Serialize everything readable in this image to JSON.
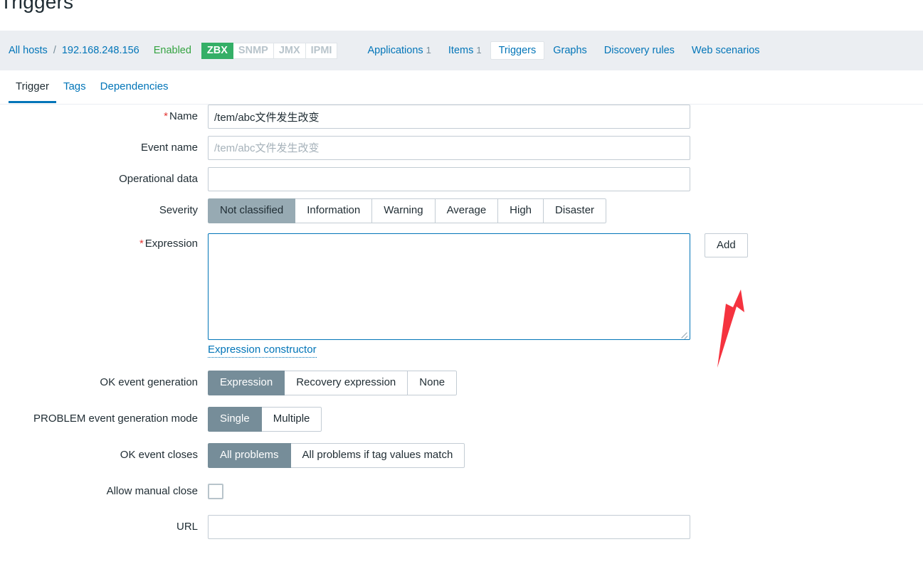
{
  "page": {
    "title": "Triggers"
  },
  "host_nav": {
    "all_hosts_label": "All hosts",
    "separator": "/",
    "host_name": "192.168.248.156",
    "status": "Enabled",
    "interfaces": [
      {
        "label": "ZBX",
        "active": true
      },
      {
        "label": "SNMP",
        "active": false
      },
      {
        "label": "JMX",
        "active": false
      },
      {
        "label": "IPMI",
        "active": false
      }
    ],
    "links": [
      {
        "label": "Applications",
        "count": "1",
        "selected": false
      },
      {
        "label": "Items",
        "count": "1",
        "selected": false
      },
      {
        "label": "Triggers",
        "count": "",
        "selected": true
      },
      {
        "label": "Graphs",
        "count": "",
        "selected": false
      },
      {
        "label": "Discovery rules",
        "count": "",
        "selected": false
      },
      {
        "label": "Web scenarios",
        "count": "",
        "selected": false
      }
    ]
  },
  "tabs": [
    {
      "label": "Trigger",
      "active": true
    },
    {
      "label": "Tags",
      "active": false
    },
    {
      "label": "Dependencies",
      "active": false
    }
  ],
  "form": {
    "name": {
      "label": "Name",
      "required": "*",
      "value": "/tem/abc文件发生改变",
      "placeholder": ""
    },
    "event_name": {
      "label": "Event name",
      "value": "",
      "placeholder": "/tem/abc文件发生改变"
    },
    "operational_data": {
      "label": "Operational data",
      "value": "",
      "placeholder": ""
    },
    "severity": {
      "label": "Severity",
      "options": [
        "Not classified",
        "Information",
        "Warning",
        "Average",
        "High",
        "Disaster"
      ],
      "selected": "Not classified"
    },
    "expression": {
      "label": "Expression",
      "required": "*",
      "value": "",
      "constructor_link": "Expression constructor",
      "add_button": "Add"
    },
    "ok_event_generation": {
      "label": "OK event generation",
      "options": [
        "Expression",
        "Recovery expression",
        "None"
      ],
      "selected": "Expression"
    },
    "problem_event_generation_mode": {
      "label": "PROBLEM event generation mode",
      "options": [
        "Single",
        "Multiple"
      ],
      "selected": "Single"
    },
    "ok_event_closes": {
      "label": "OK event closes",
      "options": [
        "All problems",
        "All problems if tag values match"
      ],
      "selected": "All problems"
    },
    "allow_manual_close": {
      "label": "Allow manual close",
      "checked": false
    },
    "url": {
      "label": "URL",
      "value": "",
      "placeholder": ""
    }
  },
  "annotation": {
    "arrow_color": "#f5333f"
  },
  "colors": {
    "link": "#0275b8",
    "status_enabled": "#34a341",
    "interface_active": "#34af67",
    "segment_active": "#768d99",
    "segment_active_muted": "#97aab3",
    "nav_bar_bg": "#ebeef2",
    "required_star": "#e33734"
  }
}
